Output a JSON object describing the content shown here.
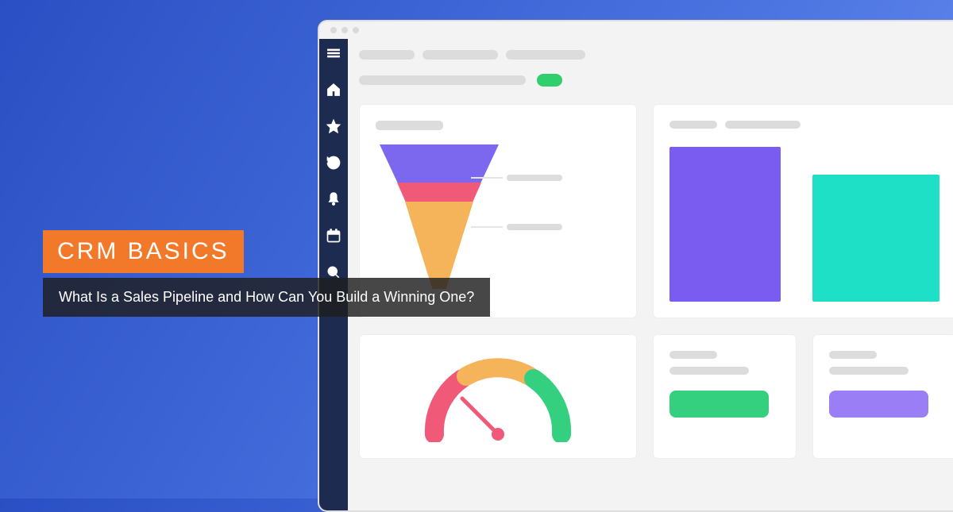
{
  "overlay": {
    "tag": "CRM BASICS",
    "subtitle": "What Is a Sales Pipeline and How Can You Build a Winning One?"
  },
  "sidebar": {
    "icons": [
      "menu-icon",
      "home-icon",
      "star-icon",
      "history-icon",
      "bell-icon",
      "calendar-icon",
      "search-icon"
    ]
  },
  "funnel": {
    "colors": {
      "top": "#7b68ee",
      "mid": "#f05a78",
      "bottom": "#f5b35a"
    }
  },
  "bars": {
    "colors": {
      "a": "#7b5cf0",
      "b": "#1ee0c7"
    }
  },
  "gauge": {
    "colors": {
      "left": "#f05a78",
      "mid": "#f5b35a",
      "right": "#35d07f"
    }
  },
  "pills": {
    "colors": {
      "green": "#35d07f",
      "purple": "#9a7ef5"
    }
  }
}
